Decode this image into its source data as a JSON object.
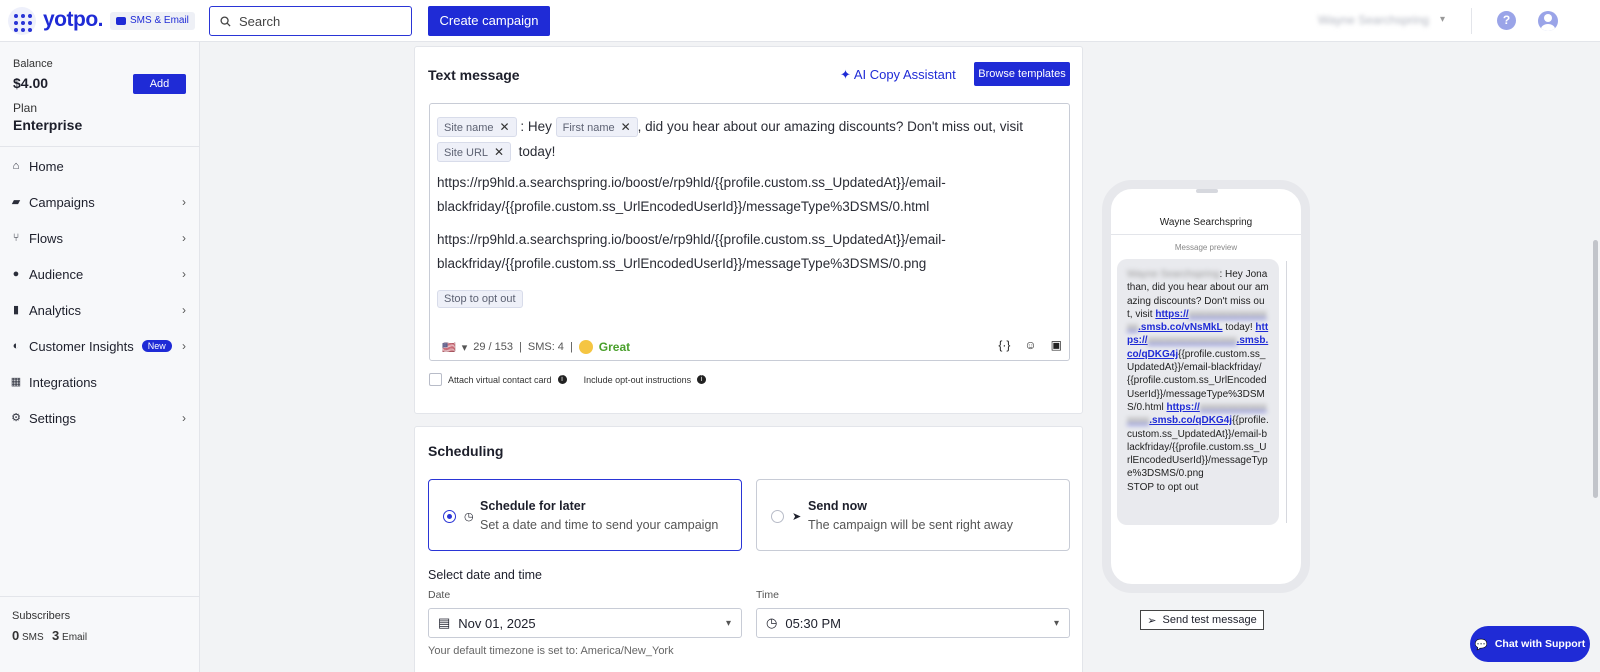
{
  "topbar": {
    "logo": "yotpo.",
    "product_badge": "SMS & Email",
    "search_placeholder": "Search",
    "create_campaign": "Create campaign",
    "account_name": "Wayne Searchspring"
  },
  "sidebar": {
    "balance_label": "Balance",
    "balance_value": "$4.00",
    "add_label": "Add",
    "plan_label": "Plan",
    "plan_value": "Enterprise",
    "items": [
      {
        "label": "Home",
        "icon": "home-icon",
        "chevron": false
      },
      {
        "label": "Campaigns",
        "icon": "campaigns-icon",
        "chevron": true
      },
      {
        "label": "Flows",
        "icon": "flows-icon",
        "chevron": true
      },
      {
        "label": "Audience",
        "icon": "audience-icon",
        "chevron": true
      },
      {
        "label": "Analytics",
        "icon": "analytics-icon",
        "chevron": true
      },
      {
        "label": "Customer Insights",
        "icon": "insights-icon",
        "chevron": true,
        "badge": "New"
      },
      {
        "label": "Integrations",
        "icon": "integrations-icon",
        "chevron": false
      },
      {
        "label": "Settings",
        "icon": "settings-icon",
        "chevron": true
      }
    ],
    "subscribers_label": "Subscribers",
    "sms_count": "0",
    "sms_label": "SMS",
    "email_count": "3",
    "email_label": "Email"
  },
  "text_message": {
    "title": "Text message",
    "ai_assistant": "AI Copy Assistant",
    "browse_templates": "Browse templates",
    "chip_site_name": "Site name",
    "chip_first_name": "First name",
    "chip_site_url": "Site URL",
    "chip_opt_out": "Stop to opt out",
    "text_hey": ": Hey",
    "text_discount": ", did you hear about our amazing discounts? Don't miss out, visit",
    "text_today": "today!",
    "url1_line1": "https://rp9hld.a.searchspring.io/boost/e/rp9hld/{{profile.custom.ss_UpdatedAt}}/email-",
    "url1_line2": "blackfriday/{{profile.custom.ss_UrlEncodedUserId}}/messageType%3DSMS/0.html",
    "url2_line1": "https://rp9hld.a.searchspring.io/boost/e/rp9hld/{{profile.custom.ss_UpdatedAt}}/email-",
    "url2_line2": "blackfriday/{{profile.custom.ss_UrlEncodedUserId}}/messageType%3DSMS/0.png",
    "char_count": "29 / 153",
    "sms_count": "SMS: 4",
    "quality": "Great",
    "attach_card": "Attach virtual contact card",
    "include_opt_out": "Include opt-out instructions"
  },
  "scheduling": {
    "title": "Scheduling",
    "later_title": "Schedule for later",
    "later_sub": "Set a date and time to send your campaign",
    "now_title": "Send now",
    "now_sub": "The campaign will be sent right away",
    "select_label": "Select date and time",
    "date_label": "Date",
    "date_value": "Nov 01, 2025",
    "time_label": "Time",
    "time_value": "05:30 PM",
    "timezone_note": "Your default timezone is set to: America/New_York"
  },
  "preview": {
    "store_name": "Wayne Searchspring",
    "message_preview": "Message preview",
    "blurred_sender": "Wayne Searchspring",
    "hey_text": ": Hey Jonathan, did you hear about our amazing discounts? Don't miss out, visit",
    "link1_a": "https://",
    "link1_b": "smsb.co/vNsMkL",
    "today": " today!",
    "link2_a": "https://",
    "link2_b": "smsb.co/qDKG4j",
    "tail2": "{{profile.custom.ss_UpdatedAt}}/email-blackfriday/{{profile.custom.ss_UrlEncodedUserId}}/messageType%3DSMS/0.html",
    "link3_a": "https://",
    "link3_b": "smsb.co/qDKG4j",
    "tail3": "{{profile.custom.ss_UpdatedAt}}/email-blackfriday/{{profile.custom.ss_UrlEncodedUserId}}/messageType%3DSMS/0.png",
    "stop": "STOP to opt out",
    "send_test": "Send test message"
  },
  "chat_support": "Chat with Support"
}
